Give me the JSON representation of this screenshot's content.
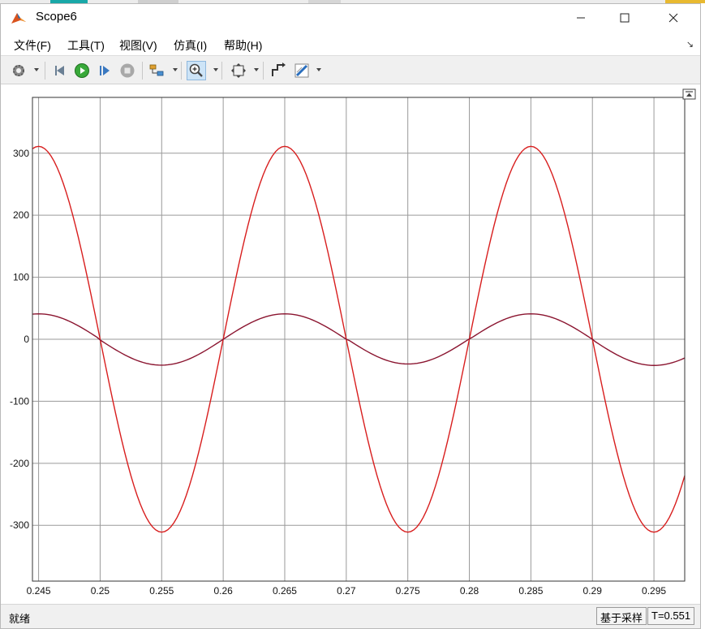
{
  "window": {
    "title": "Scope6"
  },
  "menu": [
    "文件(F)",
    "工具(T)",
    "视图(V)",
    "仿真(I)",
    "帮助(H)"
  ],
  "toolbar": {
    "buttons": [
      "settings-icon",
      "step-back-icon",
      "run-icon",
      "step-forward-icon",
      "stop-icon",
      "highlight-block-icon",
      "zoom-icon",
      "fit-to-view-icon",
      "signal-icon",
      "style-icon"
    ],
    "active": "zoom-icon"
  },
  "status": {
    "text": "就绪",
    "sample_mode": "基于采样",
    "time": "T=0.551"
  },
  "colors": {
    "series_a": "#d81e1e",
    "series_b": "#8b1530",
    "grid": "#9a9a9a"
  },
  "chart_data": {
    "type": "line",
    "title": "",
    "xlabel": "",
    "ylabel": "",
    "xlim": [
      0.2445,
      0.2975
    ],
    "ylim": [
      -390,
      390
    ],
    "xticks": [
      "0.245",
      "0.25",
      "0.255",
      "0.26",
      "0.265",
      "0.27",
      "0.275",
      "0.28",
      "0.285",
      "0.29",
      "0.295"
    ],
    "yticks": [
      "300",
      "200",
      "100",
      "0",
      "-100",
      "-200",
      "-300"
    ],
    "grid": true,
    "series": [
      {
        "color": "#d81e1e",
        "waveform": "cosine",
        "amplitude": 311,
        "frequency_hz": 50,
        "phase_ref_t": 0.245,
        "x_sample_step": 0.00025
      },
      {
        "color": "#8b1530",
        "waveform": "cosine",
        "amplitude": 41,
        "frequency_hz": 50,
        "phase_ref_t": 0.245,
        "x_sample_step": 0.00025
      }
    ]
  }
}
